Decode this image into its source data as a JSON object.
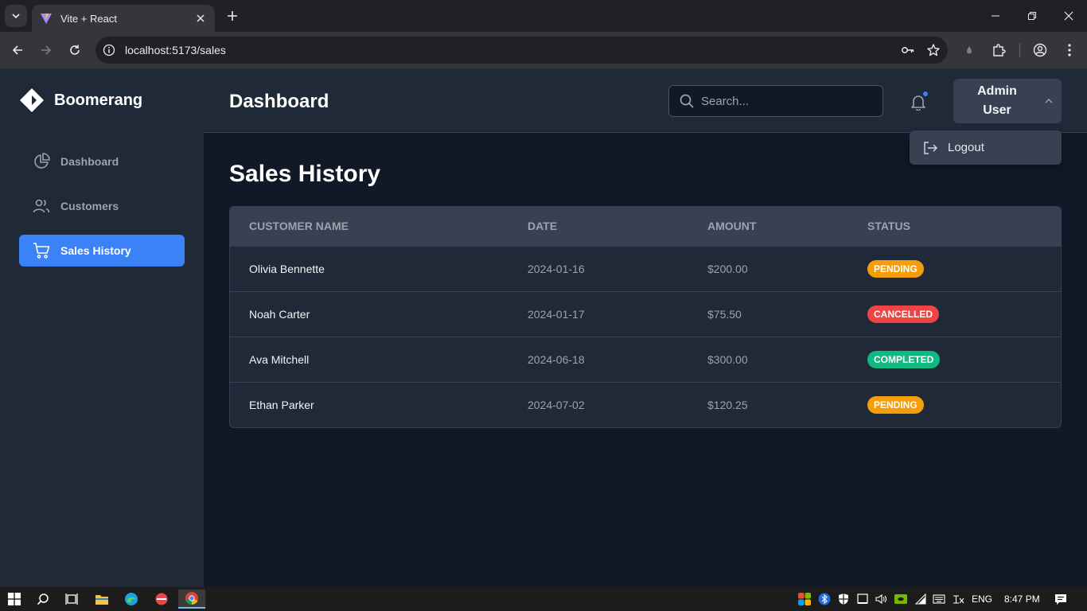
{
  "browser": {
    "tab_title": "Vite + React",
    "url": "localhost:5173/sales"
  },
  "app": {
    "brand": "Boomerang",
    "sidebar": {
      "items": [
        {
          "label": "Dashboard",
          "icon": "pie-chart-icon",
          "active": false
        },
        {
          "label": "Customers",
          "icon": "users-icon",
          "active": false
        },
        {
          "label": "Sales History",
          "icon": "cart-icon",
          "active": true
        }
      ]
    },
    "header": {
      "title": "Dashboard",
      "search_placeholder": "Search...",
      "user_line1": "Admin",
      "user_line2": "User",
      "notification_dot": true
    },
    "dropdown": {
      "logout_label": "Logout"
    },
    "main": {
      "page_title": "Sales History",
      "table": {
        "columns": [
          "CUSTOMER NAME",
          "DATE",
          "AMOUNT",
          "STATUS"
        ],
        "rows": [
          {
            "customer": "Olivia Bennette",
            "date": "2024-01-16",
            "amount": "$200.00",
            "status": "PENDING"
          },
          {
            "customer": "Noah Carter",
            "date": "2024-01-17",
            "amount": "$75.50",
            "status": "CANCELLED"
          },
          {
            "customer": "Ava Mitchell",
            "date": "2024-06-18",
            "amount": "$300.00",
            "status": "COMPLETED"
          },
          {
            "customer": "Ethan Parker",
            "date": "2024-07-02",
            "amount": "$120.25",
            "status": "PENDING"
          }
        ]
      }
    }
  },
  "colors": {
    "accent": "#3b82f6",
    "pending": "#f59e0b",
    "cancelled": "#ef4444",
    "completed": "#10b981",
    "sidebar_bg": "#1f2937",
    "main_bg": "#111827"
  },
  "taskbar": {
    "language": "ENG",
    "time": "8:47 PM"
  }
}
